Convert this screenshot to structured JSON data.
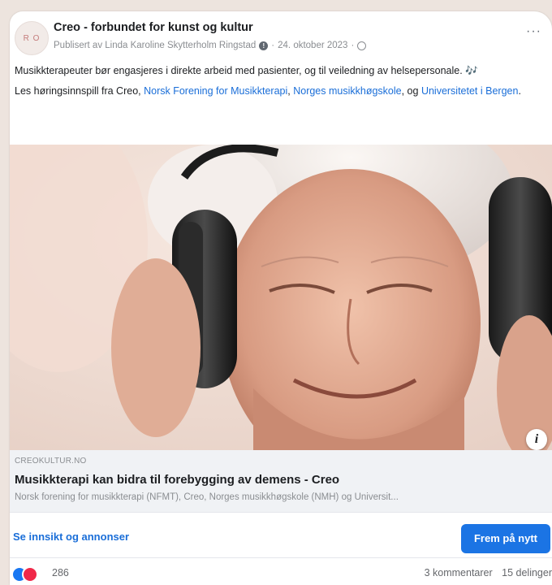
{
  "post": {
    "avatar_text": "R O",
    "page_name": "Creo - forbundet for kunst og kultur",
    "meta": {
      "published_by": "Publisert av Linda Karoline Skytterholm Ringstad",
      "date": "24. oktober 2023"
    },
    "text_line1": "Musikkterapeuter bør engasjeres i direkte arbeid med pasienter, og til veiledning av helsepersonale. 🎶",
    "text_line2_prefix": "Les høringsinnspill fra Creo, ",
    "link1": "Norsk Forening for Musikkterapi",
    "sep1": ", ",
    "link2": "Norges musikkhøgskole",
    "sep2": ", og ",
    "link3": "Universitetet i Bergen",
    "suffix": "."
  },
  "image": {
    "info_badge": "i"
  },
  "link_preview": {
    "domain": "CREOKULTUR.NO",
    "title": "Musikkterapi kan bidra til forebygging av demens - Creo",
    "description": "Norsk forening for musikkterapi (NFMT), Creo, Norges musikkhøgskole (NMH) og Universit..."
  },
  "actions": {
    "insight_label": "Se innsikt og annonser",
    "boost_label": "Frem på nytt"
  },
  "stats": {
    "reaction_count": "286",
    "comments": "3 kommentarer",
    "shares": "15 delinger"
  },
  "colors": {
    "accent": "#1b74e4",
    "link": "#1a6ed8",
    "like": "#1877f2",
    "love": "#f02849"
  },
  "icons": [
    "more-icon",
    "privacy-icon",
    "globe-icon",
    "info-icon",
    "like-reaction-icon",
    "love-reaction-icon"
  ]
}
